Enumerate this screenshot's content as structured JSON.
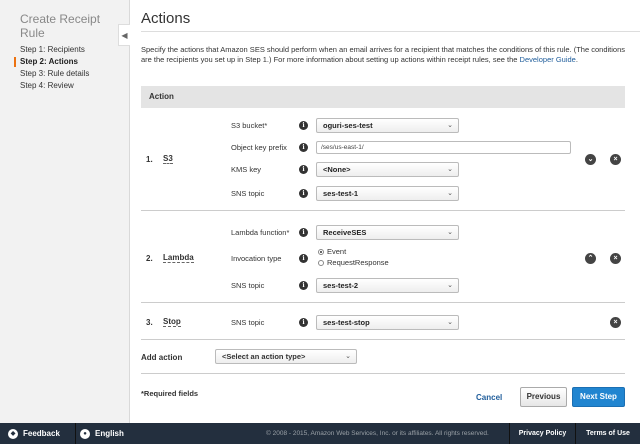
{
  "sidebar": {
    "title": "Create Receipt Rule",
    "steps": [
      {
        "label": "Step 1: Recipients"
      },
      {
        "label": "Step 2: Actions"
      },
      {
        "label": "Step 3: Rule details"
      },
      {
        "label": "Step 4: Review"
      }
    ],
    "active_step_index": 1
  },
  "page": {
    "title": "Actions",
    "description": "Specify the actions that Amazon SES should perform when an email arrives for a recipient that matches the conditions of this rule. (The conditions are the recipients you set up in Step 1.) For more information about setting up actions within receipt rules, see the",
    "description_link": "Developer Guide",
    "description_end": "."
  },
  "table": {
    "header": "Action",
    "rows": [
      {
        "number": "1.",
        "name": "S3",
        "fields": {
          "bucket_label": "S3 bucket*",
          "bucket_value": "oguri-ses-test",
          "prefix_label": "Object key prefix",
          "prefix_value": "/ses/us-east-1/",
          "kms_label": "KMS key",
          "kms_value": "<None>",
          "sns_label": "SNS topic",
          "sns_value": "ses-test-1"
        }
      },
      {
        "number": "2.",
        "name": "Lambda",
        "fields": {
          "function_label": "Lambda function*",
          "function_value": "ReceiveSES",
          "invocation_label": "Invocation type",
          "option_event": "Event",
          "option_request": "RequestResponse",
          "selected_option": "Event",
          "sns_label": "SNS topic",
          "sns_value": "ses-test-2"
        }
      },
      {
        "number": "3.",
        "name": "Stop",
        "fields": {
          "sns_label": "SNS topic",
          "sns_value": "ses-test-stop"
        }
      }
    ]
  },
  "add_action": {
    "label": "Add action",
    "select_value": "<Select an action type>"
  },
  "form": {
    "required_note": "*Required fields",
    "cancel": "Cancel",
    "previous": "Previous",
    "next": "Next Step"
  },
  "footer": {
    "feedback": "Feedback",
    "language": "English",
    "copyright": "© 2008 - 2015, Amazon Web Services, Inc. or its affiliates. All rights reserved.",
    "privacy": "Privacy Policy",
    "terms": "Terms of Use"
  },
  "colors": {
    "accent_orange": "#ec7211",
    "link_blue": "#1f5d9b",
    "primary_button": "#2185d0",
    "footer_bg": "#232f3e"
  }
}
